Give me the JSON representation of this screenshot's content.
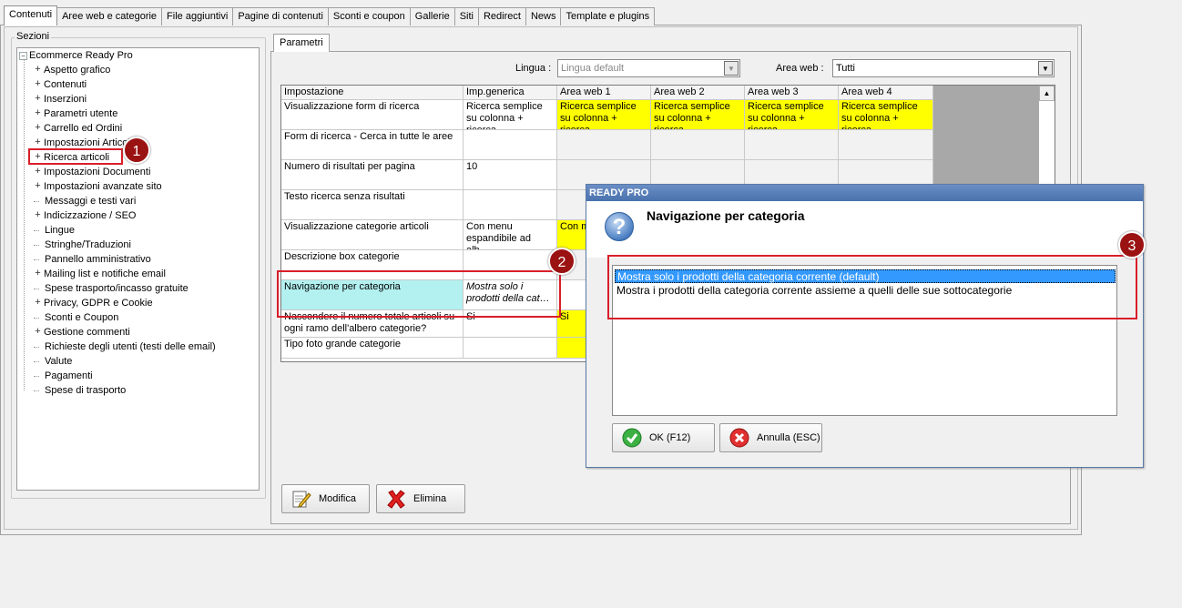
{
  "top_tabs": [
    "Contenuti",
    "Aree web e categorie",
    "File aggiuntivi",
    "Pagine di contenuti",
    "Sconti e coupon",
    "Gallerie",
    "Siti",
    "Redirect",
    "News",
    "Template e plugins"
  ],
  "sections": {
    "legend": "Sezioni",
    "root": "Ecommerce Ready Pro",
    "items": [
      {
        "label": "Aspetto grafico",
        "expandable": true
      },
      {
        "label": "Contenuti",
        "expandable": true
      },
      {
        "label": "Inserzioni",
        "expandable": true
      },
      {
        "label": "Parametri utente",
        "expandable": true
      },
      {
        "label": "Carrello ed Ordini",
        "expandable": true
      },
      {
        "label": "Impostazioni Articoli",
        "expandable": true
      },
      {
        "label": "Ricerca articoli",
        "expandable": true,
        "selected": true
      },
      {
        "label": "Impostazioni Documenti",
        "expandable": true
      },
      {
        "label": "Impostazioni avanzate sito",
        "expandable": true
      },
      {
        "label": "Messaggi e testi vari",
        "expandable": false
      },
      {
        "label": "Indicizzazione / SEO",
        "expandable": true
      },
      {
        "label": "Lingue",
        "expandable": false
      },
      {
        "label": "Stringhe/Traduzioni",
        "expandable": false
      },
      {
        "label": "Pannello amministrativo",
        "expandable": false
      },
      {
        "label": "Mailing list e notifiche email",
        "expandable": true
      },
      {
        "label": "Spese trasporto/incasso gratuite",
        "expandable": false
      },
      {
        "label": "Privacy, GDPR e Cookie",
        "expandable": true
      },
      {
        "label": "Sconti e Coupon",
        "expandable": false
      },
      {
        "label": "Gestione commenti",
        "expandable": true
      },
      {
        "label": "Richieste degli utenti (testi delle email)",
        "expandable": false
      },
      {
        "label": "Valute",
        "expandable": false
      },
      {
        "label": "Pagamenti",
        "expandable": false
      },
      {
        "label": "Spese di trasporto",
        "expandable": false
      }
    ]
  },
  "params": {
    "tab": "Parametri",
    "lingua_label": "Lingua :",
    "lingua_value": "Lingua default",
    "area_label": "Area web :",
    "area_value": "Tutti",
    "columns": [
      "Impostazione",
      "Imp.generica",
      "Area web 1",
      "Area web 2",
      "Area web 3",
      "Area web 4"
    ],
    "rows": [
      {
        "name": "Visualizzazione form di ricerca",
        "generic": "Ricerca semplice su colonna + ricerca…",
        "areas": [
          "Ricerca semplice su colonna + ricerca…",
          "Ricerca semplice su colonna + ricerca…",
          "Ricerca semplice su colonna + ricerca…",
          "Ricerca semplice su colonna + ricerca…"
        ]
      },
      {
        "name": "Form di ricerca - Cerca in tutte le aree",
        "generic": "",
        "areas": [
          "",
          "",
          "",
          ""
        ]
      },
      {
        "name": "Numero di risultati per pagina",
        "generic": "10",
        "areas": [
          "",
          "",
          "",
          ""
        ]
      },
      {
        "name": "Testo ricerca senza risultati",
        "generic": "",
        "areas": [
          "",
          "",
          "",
          ""
        ]
      },
      {
        "name": "Visualizzazione categorie articoli",
        "generic": "Con menu espandibile ad alb…",
        "areas": [
          "Con m… espan…",
          "",
          "",
          ""
        ]
      },
      {
        "name": "Descrizione box categorie",
        "generic": "",
        "areas": [
          "",
          "",
          "",
          ""
        ]
      },
      {
        "name": "Navigazione per categoria",
        "generic": "Mostra solo i prodotti della cat…",
        "areas": [
          "",
          "",
          "",
          ""
        ]
      },
      {
        "name": "Nascondere il numero totale articoli su ogni ramo dell'albero categorie?",
        "generic": "Si",
        "areas": [
          "Si",
          "",
          "",
          ""
        ]
      },
      {
        "name": "Tipo foto grande categorie",
        "generic": "",
        "areas": [
          "",
          "",
          "",
          ""
        ]
      }
    ],
    "modifica": "Modifica",
    "elimina": "Elimina"
  },
  "dialog": {
    "title": "READY PRO",
    "heading": "Navigazione per categoria",
    "options": [
      "Mostra solo i prodotti della categoria corrente (default)",
      "Mostra i prodotti della categoria corrente assieme a quelli delle sue sottocategorie"
    ],
    "selected_index": 0,
    "ok": "OK (F12)",
    "cancel": "Annulla (ESC)"
  },
  "badges": [
    "1",
    "2",
    "3"
  ],
  "colors": {
    "highlight_yellow": "#ffff00",
    "highlight_cyan": "#b3f0f0",
    "annotation_red": "#d91e2a",
    "badge_red": "#9b1212",
    "selection_blue": "#3399ff"
  }
}
